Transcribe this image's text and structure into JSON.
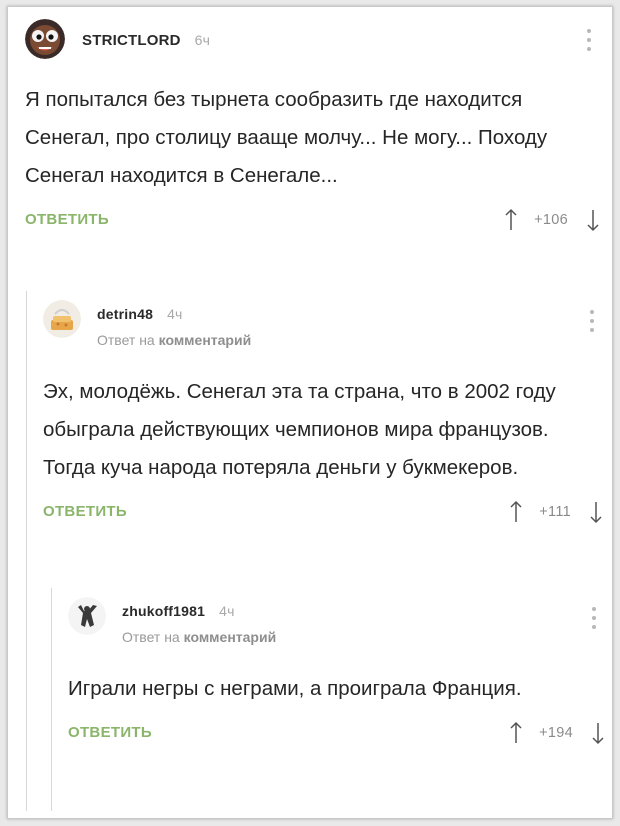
{
  "comments": [
    {
      "author": "STRICTLORD",
      "time": "6ч",
      "text": "Я попытался без тырнета сообразить где находится Сенегал, про столицу вааще молчу... Не могу... Походу Сенегал находится в Сенегале...",
      "reply_label": "ОТВЕТИТЬ",
      "score": "+106"
    },
    {
      "author": "detrin48",
      "time": "4ч",
      "reply_to_prefix": "Ответ на",
      "reply_to_target": "комментарий",
      "text": "Эх, молодёжь. Сенегал эта та страна, что в 2002 году обыграла действующих чемпионов мира французов. Тогда куча народа потеряла деньги у букмекеров.",
      "reply_label": "ОТВЕТИТЬ",
      "score": "+111"
    },
    {
      "author": "zhukoff1981",
      "time": "4ч",
      "reply_to_prefix": "Ответ на",
      "reply_to_target": "комментарий",
      "text": "Играли негры с неграми, а проиграла Франция.",
      "reply_label": "ОТВЕТИТЬ",
      "score": "+194"
    }
  ],
  "colors": {
    "accent": "#8ab56a",
    "muted": "#a8a8a8",
    "text": "#262626"
  },
  "icons": [
    "more-icon",
    "upvote-icon",
    "downvote-icon",
    "avatar-image"
  ]
}
